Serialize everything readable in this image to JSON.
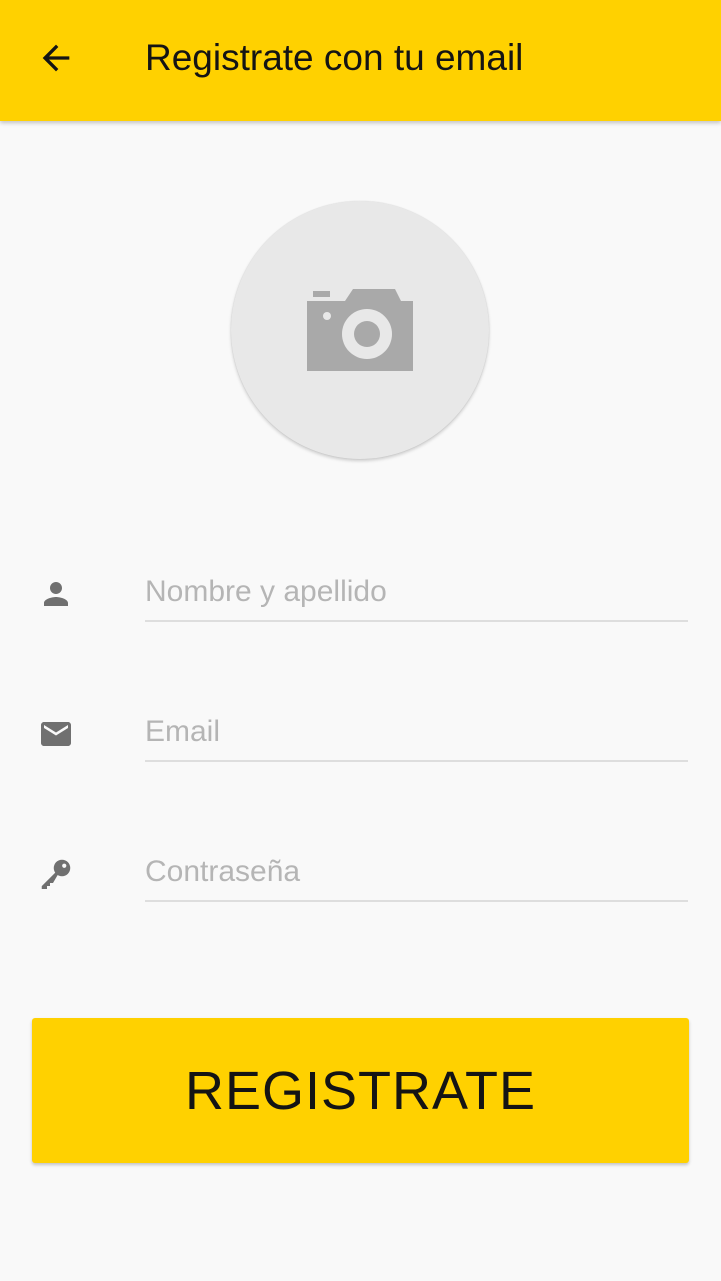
{
  "app_bar": {
    "title": "Registrate con tu email",
    "back_icon": "arrow-back-icon",
    "background": "#ffd100"
  },
  "avatar": {
    "icon": "camera-icon"
  },
  "form": {
    "name": {
      "icon": "person-icon",
      "placeholder": "Nombre y apellido",
      "value": ""
    },
    "email": {
      "icon": "mail-icon",
      "placeholder": "Email",
      "value": ""
    },
    "password": {
      "icon": "key-icon",
      "placeholder": "Contraseña",
      "value": ""
    }
  },
  "submit": {
    "label": "REGISTRATE"
  },
  "colors": {
    "accent": "#ffd100",
    "background": "#f9f9f9",
    "icon_gray": "#707070",
    "placeholder_gray": "#b5b5b5"
  }
}
